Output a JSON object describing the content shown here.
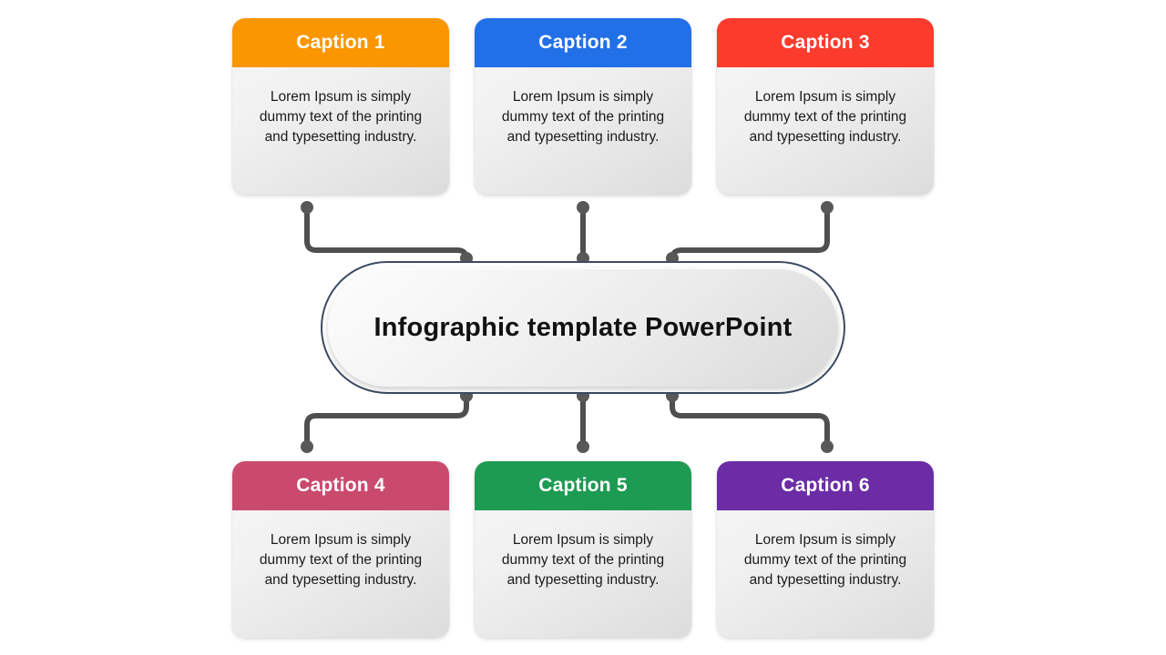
{
  "slide": {
    "background_color": "#ffffff",
    "center": {
      "title": "Infographic template PowerPoint",
      "outline_color": "#3c4a63"
    },
    "connector": {
      "line_color": "#4f4f4f",
      "endpoint_color": "#585858"
    },
    "body_text": "Lorem Ipsum is simply dummy text of the printing and typesetting industry.",
    "cards": [
      {
        "id": "card-1",
        "caption": "Caption 1",
        "color": "#fa9600",
        "body": "Lorem Ipsum is simply dummy text of the printing and typesetting industry.",
        "position": "top-left"
      },
      {
        "id": "card-2",
        "caption": "Caption 2",
        "color": "#2170e8",
        "body": "Lorem Ipsum is simply dummy text of the printing and typesetting industry.",
        "position": "top-center"
      },
      {
        "id": "card-3",
        "caption": "Caption 3",
        "color": "#fb3b2c",
        "body": "Lorem Ipsum is simply dummy text of the printing and typesetting industry.",
        "position": "top-right"
      },
      {
        "id": "card-4",
        "caption": "Caption 4",
        "color": "#ca4a6e",
        "body": "Lorem Ipsum is simply dummy text of the printing and typesetting industry.",
        "position": "bottom-left"
      },
      {
        "id": "card-5",
        "caption": "Caption 5",
        "color": "#1e9b53",
        "body": "Lorem Ipsum is simply dummy text of the printing and typesetting industry.",
        "position": "bottom-center"
      },
      {
        "id": "card-6",
        "caption": "Caption 6",
        "color": "#6b2ca5",
        "body": "Lorem Ipsum is simply dummy text of the printing and typesetting industry.",
        "position": "bottom-right"
      }
    ]
  }
}
